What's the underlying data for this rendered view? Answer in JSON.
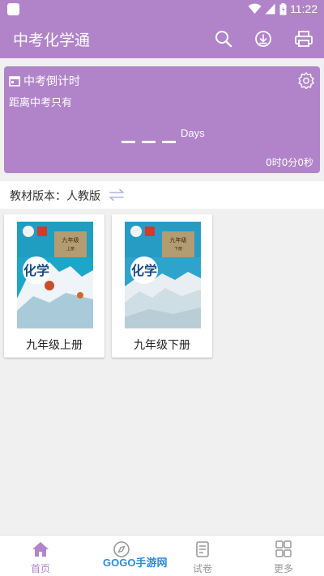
{
  "status_bar": {
    "time": "11:22"
  },
  "app_bar": {
    "title": "中考化学通",
    "icons": [
      "search-icon",
      "download-icon",
      "print-icon"
    ]
  },
  "countdown": {
    "title": "中考倒计时",
    "subtitle": "距离中考只有",
    "days_unit": "Days",
    "remaining": "0时0分0秒"
  },
  "edition": {
    "label": "教材版本：人教版"
  },
  "books": [
    {
      "name": "九年级上册",
      "cover_grade": "九年级",
      "cover_volume": "上册",
      "cover_title": "化学"
    },
    {
      "name": "九年级下册",
      "cover_grade": "九年级",
      "cover_volume": "下册",
      "cover_title": "化学"
    }
  ],
  "bottom_nav": [
    {
      "label": "首页",
      "icon": "home-icon",
      "active": true
    },
    {
      "label": "",
      "icon": "compass-icon",
      "active": false
    },
    {
      "label": "试卷",
      "icon": "exam-paper-icon",
      "active": false
    },
    {
      "label": "更多",
      "icon": "grid-icon",
      "active": false
    }
  ],
  "watermark": "GOGO手游网",
  "colors": {
    "primary": "#b184c9",
    "background": "#f0f0f0"
  }
}
